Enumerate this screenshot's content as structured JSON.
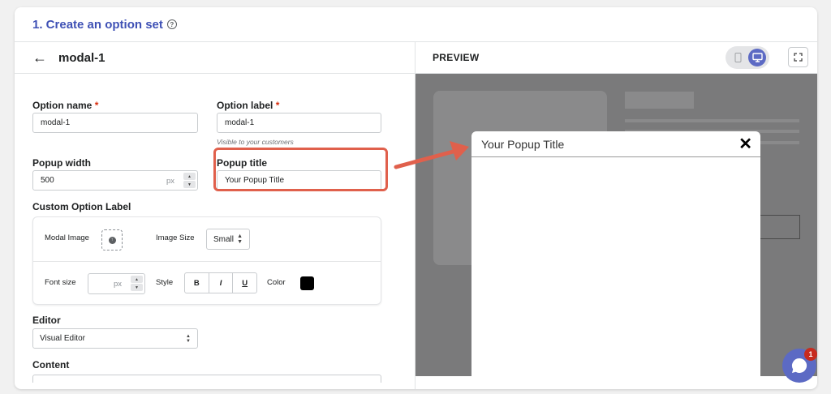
{
  "header": {
    "title": "1. Create an option set",
    "help_icon": "question-circle-icon"
  },
  "editor": {
    "title": "modal-1",
    "option_name": {
      "label": "Option name",
      "required": "*",
      "value": "modal-1"
    },
    "option_label": {
      "label": "Option label",
      "required": "*",
      "value": "modal-1",
      "hint": "Visible to your customers"
    },
    "popup_width": {
      "label": "Popup width",
      "value": "500",
      "unit": "px"
    },
    "popup_title": {
      "label": "Popup title",
      "value": "Your Popup Title"
    },
    "custom_option_label": {
      "heading": "Custom Option Label",
      "modal_image_label": "Modal Image",
      "image_size_label": "Image Size",
      "image_size_value": "Small",
      "font_size_label": "Font size",
      "font_size_unit": "px",
      "style_label": "Style",
      "style_buttons": [
        "B",
        "I",
        "U"
      ],
      "color_label": "Color",
      "color_value": "#000000"
    },
    "editor_field": {
      "label": "Editor",
      "value": "Visual Editor"
    },
    "content_label": "Content"
  },
  "preview": {
    "label": "PREVIEW",
    "modal_title": "Your Popup Title",
    "close_glyph": "✕"
  },
  "chat": {
    "badge_count": "1"
  },
  "colors": {
    "accent": "#3f51b5",
    "highlight": "#e0604c",
    "toggle_active": "#5c6ac4"
  }
}
